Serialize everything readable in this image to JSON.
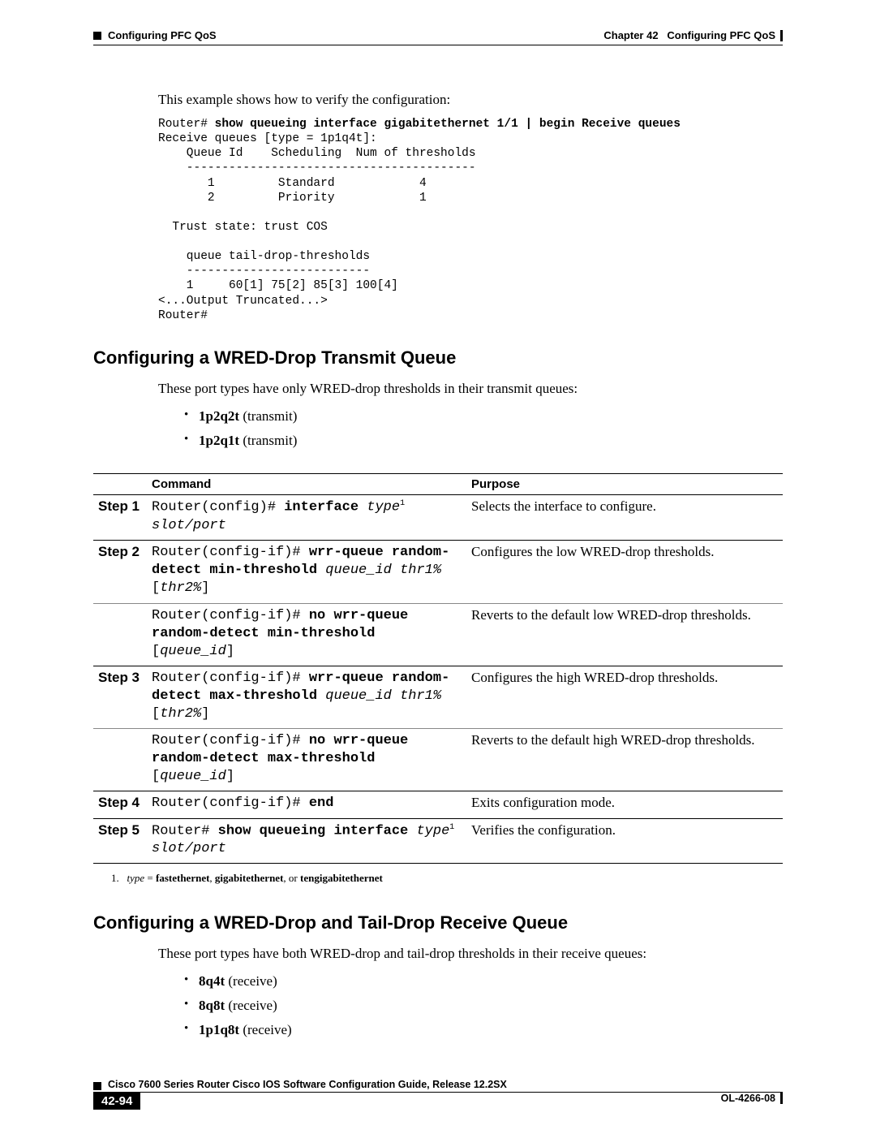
{
  "header": {
    "chapter": "Chapter 42",
    "chapter_title": "Configuring PFC QoS",
    "section_left": "Configuring PFC QoS"
  },
  "intro_text": "This example shows how to verify the configuration:",
  "cli_output": {
    "prompt1": "Router# ",
    "cmd1": "show queueing interface gigabitethernet 1/1 | begin Receive queues",
    "rest": "Receive queues [type = 1p1q4t]:\n    Queue Id    Scheduling  Num of thresholds\n    -----------------------------------------\n       1         Standard            4\n       2         Priority            1\n\n  Trust state: trust COS\n\n    queue tail-drop-thresholds\n    --------------------------\n    1     60[1] 75[2] 85[3] 100[4] \n<...Output Truncated...>\nRouter#"
  },
  "section1": {
    "heading": "Configuring a WRED-Drop Transmit Queue",
    "intro": "These port types have only WRED-drop thresholds in their transmit queues:",
    "bullets": [
      {
        "b": "1p2q2t",
        "t": " (transmit)"
      },
      {
        "b": "1p2q1t",
        "t": " (transmit)"
      }
    ],
    "table": {
      "headers": {
        "command": "Command",
        "purpose": "Purpose"
      },
      "rows": [
        {
          "step": "Step 1",
          "thin": false,
          "cmd_parts": [
            {
              "t": "Router(config)# "
            },
            {
              "t": "interface ",
              "b": true
            },
            {
              "t": "type",
              "i": true
            },
            {
              "t": "1",
              "sup": true
            },
            {
              "t": " "
            },
            {
              "t": "slot/port",
              "i": true
            }
          ],
          "purpose": "Selects the interface to configure."
        },
        {
          "step": "Step 2",
          "thin": true,
          "cmd_parts": [
            {
              "t": "Router(config-if)# "
            },
            {
              "t": "wrr-queue random-detect min-threshold",
              "b": true
            },
            {
              "t": " "
            },
            {
              "t": "queue_id thr1%",
              "i": true
            },
            {
              "t": " ["
            },
            {
              "t": "thr2%",
              "i": true
            },
            {
              "t": "]"
            }
          ],
          "purpose": "Configures the low WRED-drop thresholds."
        },
        {
          "step": "",
          "thin": false,
          "cmd_parts": [
            {
              "t": "Router(config-if)# "
            },
            {
              "t": "no wrr-queue random-detect min-threshold",
              "b": true
            },
            {
              "t": " ["
            },
            {
              "t": "queue_id",
              "i": true
            },
            {
              "t": "]"
            }
          ],
          "purpose": "Reverts to the default low WRED-drop thresholds."
        },
        {
          "step": "Step 3",
          "thin": true,
          "cmd_parts": [
            {
              "t": "Router(config-if)# "
            },
            {
              "t": "wrr-queue random-detect max-threshold",
              "b": true
            },
            {
              "t": " "
            },
            {
              "t": "queue_id thr1%",
              "i": true
            },
            {
              "t": " ["
            },
            {
              "t": "thr2%",
              "i": true
            },
            {
              "t": "]"
            }
          ],
          "purpose": "Configures the high WRED-drop thresholds."
        },
        {
          "step": "",
          "thin": false,
          "cmd_parts": [
            {
              "t": "Router(config-if)# "
            },
            {
              "t": "no wrr-queue random-detect max-threshold",
              "b": true
            },
            {
              "t": " ["
            },
            {
              "t": "queue_id",
              "i": true
            },
            {
              "t": "]"
            }
          ],
          "purpose": "Reverts to the default high WRED-drop thresholds."
        },
        {
          "step": "Step 4",
          "thin": false,
          "cmd_parts": [
            {
              "t": "Router(config-if)# "
            },
            {
              "t": "end",
              "b": true
            }
          ],
          "purpose": "Exits configuration mode."
        },
        {
          "step": "Step 5",
          "thin": false,
          "cmd_parts": [
            {
              "t": "Router# "
            },
            {
              "t": "show queueing interface",
              "b": true
            },
            {
              "t": " "
            },
            {
              "t": "type",
              "i": true
            },
            {
              "t": "1",
              "sup": true
            },
            {
              "t": " "
            },
            {
              "t": "slot/port",
              "i": true
            }
          ],
          "purpose": "Verifies the configuration."
        }
      ],
      "footnote": {
        "num": "1.",
        "type_word": "type",
        "eq": " = ",
        "opts": "fastethernet",
        "sep1": ", ",
        "opt2": "gigabitethernet",
        "sep2": ", or ",
        "opt3": "tengigabitethernet"
      }
    }
  },
  "section2": {
    "heading": "Configuring a WRED-Drop and Tail-Drop Receive Queue",
    "intro": "These port types have both WRED-drop and tail-drop thresholds in their receive queues:",
    "bullets": [
      {
        "b": "8q4t",
        "t": " (receive)"
      },
      {
        "b": "8q8t",
        "t": " (receive)"
      },
      {
        "b": "1p1q8t",
        "t": " (receive)"
      }
    ]
  },
  "footer": {
    "book_title": "Cisco 7600 Series Router Cisco IOS Software Configuration Guide, Release 12.2SX",
    "page_number": "42-94",
    "doc_id": "OL-4266-08"
  }
}
